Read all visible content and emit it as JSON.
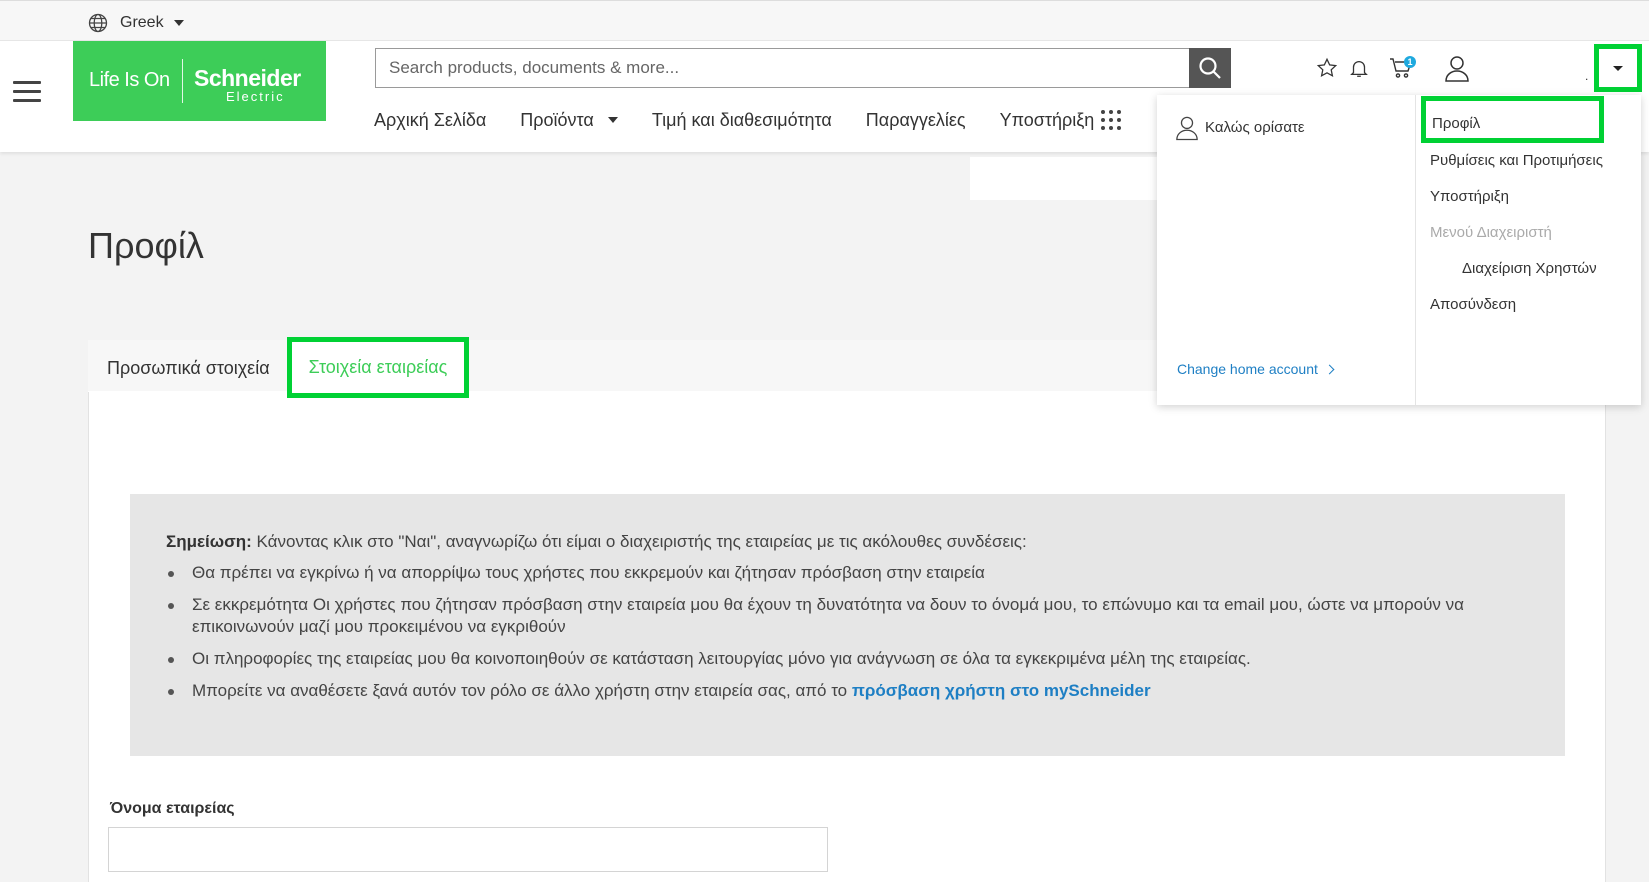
{
  "topbar": {
    "language": "Greek"
  },
  "header": {
    "logo": {
      "tagline": "Life Is On",
      "brand": "Schneider",
      "sub": "Electric"
    },
    "search": {
      "placeholder": "Search products, documents & more..."
    },
    "cart_count": "1",
    "account_dot": "."
  },
  "nav": [
    {
      "label": "Αρχική Σελίδα"
    },
    {
      "label": "Προϊόντα"
    },
    {
      "label": "Τιμή και διαθεσιμότητα"
    },
    {
      "label": "Παραγγελίες"
    },
    {
      "label": "Υποστήριξη"
    }
  ],
  "main": {
    "title": "Προφίλ",
    "tabs": [
      {
        "label": "Προσωπικά στοιχεία"
      },
      {
        "label": "Στοιχεία εταιρείας"
      }
    ],
    "note": {
      "lead_bold": "Σημείωση:",
      "lead_text": " Κάνοντας κλικ στο \"Ναι\", αναγνωρίζω ότι είμαι ο διαχειριστής της εταιρείας με τις ακόλουθες συνδέσεις:",
      "items": [
        "Θα πρέπει να εγκρίνω ή να απορρίψω τους χρήστες που εκκρεμούν και ζήτησαν πρόσβαση στην εταιρεία",
        "Σε εκκρεμότητα Οι χρήστες που ζήτησαν πρόσβαση στην εταιρεία μου θα έχουν τη δυνατότητα να δουν το όνομά μου, το επώνυμο και τα email μου, ώστε να μπορούν να επικοινωνούν μαζί μου προκειμένου να εγκριθούν",
        "Οι πληροφορίες της εταιρείας μου θα κοινοποιηθούν σε κατάσταση λειτουργίας μόνο για ανάγνωση σε όλα τα εγκεκριμένα μέλη της εταιρείας."
      ],
      "last_item_text": "Μπορείτε να αναθέσετε ξανά αυτόν τον ρόλο σε άλλο χρήστη στην εταιρεία σας, από το ",
      "last_item_link": "πρόσβαση χρήστη στο mySchneider"
    },
    "company_name_label": "Όνομα εταιρείας",
    "company_name_value": ""
  },
  "dropdown": {
    "welcome": "Καλώς ορίσατε",
    "change_account": "Change home account",
    "menu": [
      "Προφίλ",
      "Ρυθμίσεις και Προτιμήσεις",
      "Υποστήριξη",
      "Μενού Διαχειριστή",
      "Διαχείριση Χρηστών",
      "Αποσύνδεση"
    ]
  },
  "colors": {
    "brand_green": "#3dcd58",
    "highlight_green": "#00d134",
    "link_blue": "#1e7fc4"
  }
}
